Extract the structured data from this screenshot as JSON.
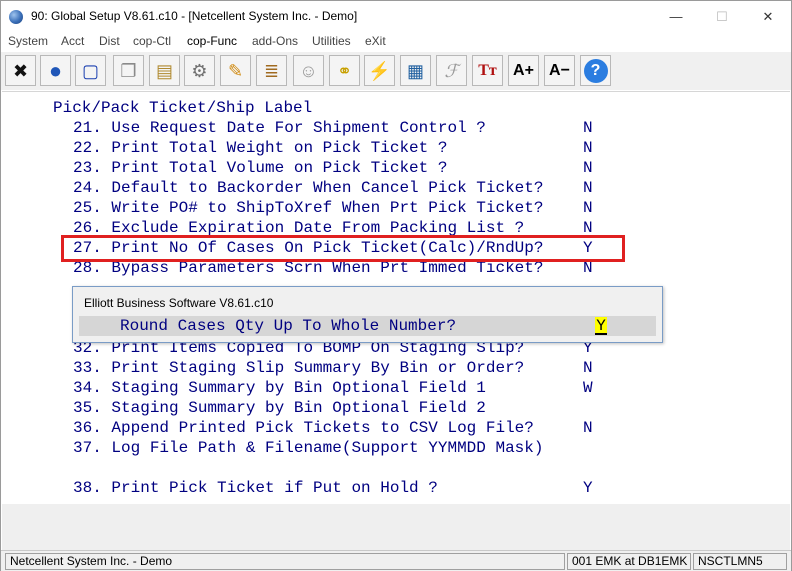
{
  "window": {
    "title": "90: Global Setup V8.61.c10 - [Netcellent System Inc. - Demo]",
    "minimize_glyph": "—",
    "maximize_glyph": "☐",
    "close_glyph": "✕"
  },
  "menu": [
    "System",
    "Acct",
    "Dist",
    "cop-Ctl",
    "cop-Func",
    "add-Ons",
    "Utilities",
    "eXit"
  ],
  "toolbar": {
    "icons": [
      "close-x-icon",
      "globe-icon",
      "select-box-icon",
      "copy-icon",
      "paste-icon",
      "settings-gear-icon",
      "edit-pencil-icon",
      "notes-icon",
      "users-icon",
      "link-chain-icon",
      "lightning-icon",
      "calendar-edit-icon",
      "signature-icon",
      "font-size-icon",
      "font-grow-icon",
      "font-shrink-icon",
      "help-icon"
    ],
    "glyphs": [
      "✖",
      "●",
      "▢",
      "❐",
      "▤",
      "⚙",
      "✎",
      "≣",
      "☺",
      "⚭",
      "⚡",
      "▦",
      "ℱ",
      "Tт",
      "A+",
      "A−",
      "?"
    ]
  },
  "screen": {
    "section_title": "Pick/Pack Ticket/Ship Label",
    "rows": [
      {
        "label": "21. Use Request Date For Shipment Control ?",
        "value": "N"
      },
      {
        "label": "22. Print Total Weight on Pick Ticket ?",
        "value": "N"
      },
      {
        "label": "23. Print Total Volume on Pick Ticket ?",
        "value": "N"
      },
      {
        "label": "24. Default to Backorder When Cancel Pick Ticket?",
        "value": "N"
      },
      {
        "label": "25. Write PO# to ShipToXref When Prt Pick Ticket?",
        "value": "N"
      },
      {
        "label": "26. Exclude Expiration Date From Packing List ?",
        "value": "N"
      },
      {
        "label": "27. Print No Of Cases On Pick Ticket(Calc)/RndUp?",
        "value": "Y"
      },
      {
        "label": "28. Bypass Parameters Scrn When Prt Immed Ticket?",
        "value": "N"
      },
      {
        "label": "32. Print Items Copied To BOMP On Staging Slip?",
        "value": "Y"
      },
      {
        "label": "33. Print Staging Slip Summary By Bin or Order?",
        "value": "N"
      },
      {
        "label": "34. Staging Summary by Bin Optional Field 1",
        "value": "W"
      },
      {
        "label": "35. Staging Summary by Bin Optional Field 2",
        "value": ""
      },
      {
        "label": "36. Append Printed Pick Tickets to CSV Log File?",
        "value": "N"
      },
      {
        "label": "37. Log File Path & Filename(Support YYMMDD Mask)",
        "value": ""
      },
      {
        "label": "38. Print Pick Ticket if Put on Hold ?",
        "value": "Y"
      }
    ]
  },
  "dialog": {
    "title": "Elliott Business Software V8.61.c10",
    "prompt": "Round Cases Qty Up To Whole Number?",
    "value": "Y"
  },
  "status": {
    "company": "Netcellent System Inc. - Demo",
    "session": "001 EMK at DB1EMK",
    "machine": "NSCTLMN5"
  },
  "colors": {
    "screen_text": "#000080",
    "highlight_border": "#e02020",
    "input_highlight": "#ffff00"
  }
}
